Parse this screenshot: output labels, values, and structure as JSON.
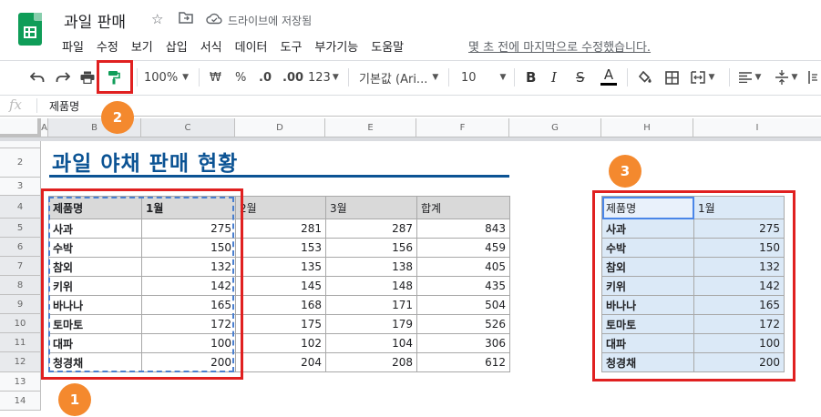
{
  "app": {
    "doc_title": "과일 판매",
    "saved_status": "드라이브에 저장됨",
    "last_edit": "몇 초 전에 마지막으로 수정했습니다."
  },
  "menu": [
    "파일",
    "수정",
    "보기",
    "삽입",
    "서식",
    "데이터",
    "도구",
    "부가기능",
    "도움말"
  ],
  "toolbar": {
    "zoom": "100%",
    "currency": "₩",
    "percent": "%",
    "decimal_decrease": ".0",
    "decimal_increase": ".00",
    "number_format": "123",
    "font": "기본값 (Ari...",
    "font_size": "10",
    "bold": "B",
    "italic": "I",
    "strike": "S",
    "text_color": "A"
  },
  "formula_bar": {
    "fx": "fx",
    "value": "제품명"
  },
  "columns": [
    "A",
    "B",
    "C",
    "D",
    "E",
    "F",
    "G",
    "H",
    "I"
  ],
  "rows": [
    "1",
    "2",
    "3",
    "4",
    "5",
    "6",
    "7",
    "8",
    "9",
    "10",
    "11",
    "12",
    "13",
    "14"
  ],
  "sheet": {
    "title": "과일 야채 판매 현황",
    "headers": [
      "제품명",
      "1월",
      "2월",
      "3월",
      "합계"
    ],
    "rows": [
      [
        "사과",
        "275",
        "281",
        "287",
        "843"
      ],
      [
        "수박",
        "150",
        "153",
        "156",
        "459"
      ],
      [
        "참외",
        "132",
        "135",
        "138",
        "405"
      ],
      [
        "키위",
        "142",
        "145",
        "148",
        "435"
      ],
      [
        "바나나",
        "165",
        "168",
        "171",
        "504"
      ],
      [
        "토마토",
        "172",
        "175",
        "179",
        "526"
      ],
      [
        "대파",
        "100",
        "102",
        "104",
        "306"
      ],
      [
        "청경채",
        "200",
        "204",
        "208",
        "612"
      ]
    ]
  },
  "copy_table": {
    "headers": [
      "제품명",
      "1월"
    ],
    "rows": [
      [
        "사과",
        "275"
      ],
      [
        "수박",
        "150"
      ],
      [
        "참외",
        "132"
      ],
      [
        "키위",
        "142"
      ],
      [
        "바나나",
        "165"
      ],
      [
        "토마토",
        "172"
      ],
      [
        "대파",
        "100"
      ],
      [
        "청경채",
        "200"
      ]
    ]
  },
  "annotations": [
    "1",
    "2",
    "3"
  ],
  "colors": {
    "accent_red": "#e02020",
    "badge_orange": "#f4892e",
    "title_blue": "#0b5394",
    "paint_format_green": "#0f9d58"
  }
}
